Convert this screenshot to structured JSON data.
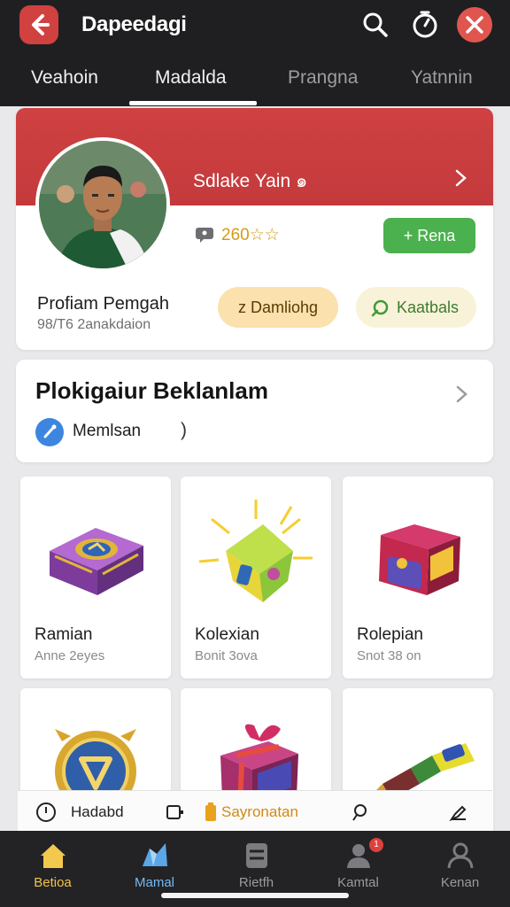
{
  "topbar": {
    "title": "Dapeedagi",
    "icons": [
      "back-arrow-icon",
      "search-icon",
      "compass-icon",
      "close-icon"
    ]
  },
  "tabs": [
    {
      "label": "Veahoin"
    },
    {
      "label": "Madalda",
      "active": true
    },
    {
      "label": "Prangna"
    },
    {
      "label": "Yatnnin"
    }
  ],
  "profile": {
    "header_name": "Sdlake Yain ๑",
    "rating": "260☆☆",
    "add_button": "+ Rena",
    "name": "Profiam Pemgah",
    "subtitle": "98/T6 2anakdaion",
    "pill_a": "z Damliohg",
    "pill_b": "Kaatbals",
    "colors": {
      "header": "#cf4142",
      "add": "#4bb14e",
      "pill_a": "#fbe1ad",
      "pill_b": "#f8f3d8"
    }
  },
  "section": {
    "title": "Plokigaiur Beklanlam",
    "member_label": "Memlsan",
    "member_suffix": ")"
  },
  "items": [
    {
      "name": "Ramian",
      "sub": "Anne 2eyes",
      "icon": "purple-chest-icon"
    },
    {
      "name": "Kolexian",
      "sub": "Bonit 3ova",
      "icon": "glowing-cube-icon"
    },
    {
      "name": "Rolepian",
      "sub": "Snot 38 on",
      "icon": "red-box-icon"
    },
    {
      "name": "",
      "sub": "",
      "icon": "gold-shield-icon"
    },
    {
      "name": "",
      "sub": "",
      "icon": "gift-box-icon"
    },
    {
      "name": "",
      "sub": "",
      "icon": "crayon-icon"
    }
  ],
  "info_strip": {
    "left": "Hadabd",
    "middle": "Sayronatan",
    "icons": [
      "clock-icon",
      "card-icon",
      "battery-icon",
      "pin-icon",
      "pen-icon"
    ]
  },
  "bottom_nav": [
    {
      "label": "Betioa",
      "icon": "home-icon",
      "state": "active-gold"
    },
    {
      "label": "Mamal",
      "icon": "map-icon",
      "state": "active-blue"
    },
    {
      "label": "Rietfh",
      "icon": "list-icon"
    },
    {
      "label": "Kamtal",
      "icon": "user-badge-icon",
      "badge": "1"
    },
    {
      "label": "Kenan",
      "icon": "profile-icon"
    }
  ]
}
